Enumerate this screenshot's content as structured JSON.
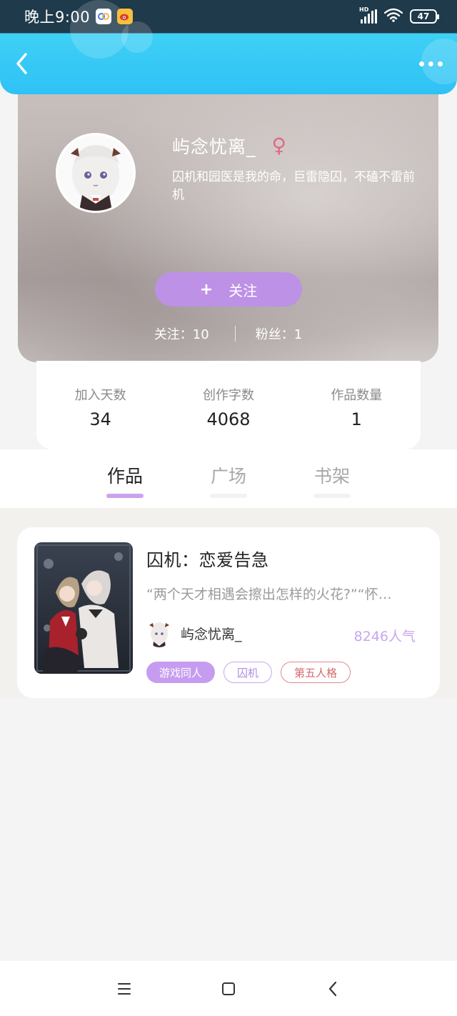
{
  "status_bar": {
    "time": "晚上9:00",
    "app_icons": [
      "baidu-netdisk-icon",
      "weibo-icon"
    ],
    "network_label": "HD",
    "battery_level": "47"
  },
  "header": {
    "back_icon": "chevron-left-icon",
    "more_icon": "more-dots-icon",
    "colors": {
      "gradient_start": "#3fd0f5",
      "gradient_end": "#2fc2f5"
    }
  },
  "profile": {
    "username": "屿念忧离_",
    "gender_symbol": "♀",
    "bio": "囚机和园医是我的命，巨雷隐囚，不磕不雷前机",
    "follow_button": {
      "icon": "+",
      "label": "关注"
    },
    "following": "关注：10",
    "followers": "粉丝：1"
  },
  "stats": [
    {
      "label": "加入天数",
      "value": "34"
    },
    {
      "label": "创作字数",
      "value": "4068"
    },
    {
      "label": "作品数量",
      "value": "1"
    }
  ],
  "tabs": [
    {
      "label": "作品",
      "active": true
    },
    {
      "label": "广场",
      "active": false
    },
    {
      "label": "书架",
      "active": false
    }
  ],
  "works": [
    {
      "title": "囚机：恋爱告急",
      "description": "“两个天才相遇会擦出怎样的火花?”“怀…",
      "author": "屿念忧离_",
      "popularity": "8246人气",
      "tags": [
        "游戏同人",
        "囚机",
        "第五人格"
      ]
    }
  ],
  "nav_bar": {
    "icons": [
      "menu-icon",
      "home-square-icon",
      "back-triangle-icon"
    ]
  },
  "colors": {
    "accent_purple": "#bd91e6",
    "tag_red": "#d56b6b",
    "female_pink": "#e16b84"
  }
}
